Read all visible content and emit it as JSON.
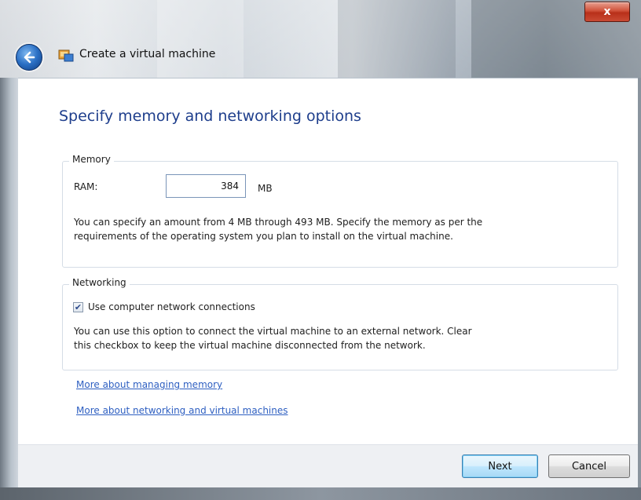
{
  "titlebar": {
    "title": "Create a virtual machine",
    "close_glyph": "x",
    "back_icon": "back-arrow-icon",
    "app_icon": "virtual-machine-icon"
  },
  "main": {
    "heading": "Specify memory and networking options",
    "memory": {
      "legend": "Memory",
      "ram_label": "RAM:",
      "ram_value": "384",
      "unit": "MB",
      "description_line1": "You can specify an amount from 4 MB through 493 MB. Specify the memory as per the",
      "description_line2": "requirements of the operating system you plan to install on the virtual machine."
    },
    "networking": {
      "legend": "Networking",
      "checkbox_checked": true,
      "checkbox_label": "Use computer network connections",
      "description_line1": "You can use this option to connect the virtual machine to an external network. Clear",
      "description_line2": "this checkbox to keep the virtual machine disconnected from the network."
    },
    "links": {
      "memory": "More about managing memory",
      "networking": "More about networking and virtual machines"
    }
  },
  "footer": {
    "next_label": "Next",
    "cancel_label": "Cancel"
  },
  "colors": {
    "heading": "#1e3e8c",
    "link": "#2e5fc1",
    "close_button": "#c94a33"
  }
}
